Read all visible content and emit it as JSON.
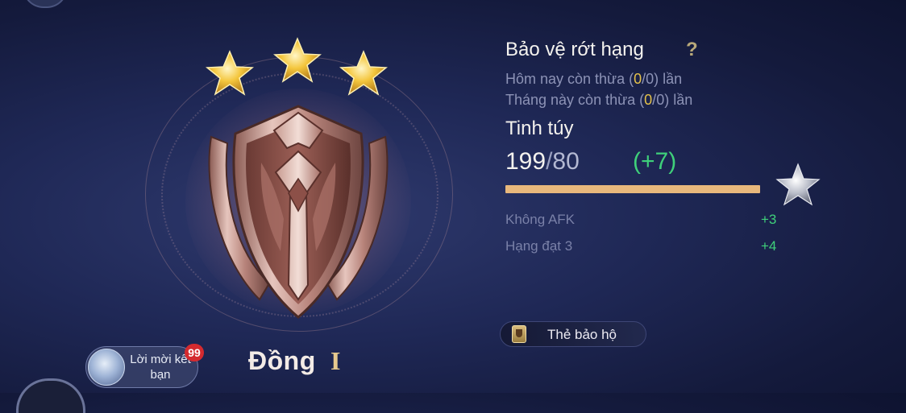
{
  "rank": {
    "name": "Đồng",
    "tier": "I",
    "stars_filled": 3,
    "stars_total": 3
  },
  "friend_invite": {
    "label": "Lời mời kết bạn",
    "badge_count": "99"
  },
  "protection": {
    "title": "Bảo vệ rớt hạng",
    "help_icon": "?",
    "today_prefix": "Hôm nay còn thừa (",
    "today_current": "0",
    "today_sep": "/",
    "today_max": "0",
    "today_suffix": ") lần",
    "month_prefix": "Tháng này còn thừa (",
    "month_current": "0",
    "month_sep": "/",
    "month_max": "0",
    "month_suffix": ") lần"
  },
  "essence": {
    "title": "Tinh túy",
    "current": "199",
    "separator": "/",
    "max": "80",
    "bonus": "(+7)",
    "progress_fraction": 1.0,
    "bonuses": [
      {
        "label": "Không AFK",
        "value": "+3"
      },
      {
        "label": "Hạng đạt 3",
        "value": "+4"
      }
    ]
  },
  "guard_card": {
    "label": "Thẻ bảo hộ",
    "icon": "guard-card-icon"
  },
  "colors": {
    "background": "#1f2856",
    "accent_gold": "#e4c14a",
    "bonus_green": "#3fd07a",
    "progress_bar": "#e8b87c",
    "badge_red": "#d42a2f"
  }
}
